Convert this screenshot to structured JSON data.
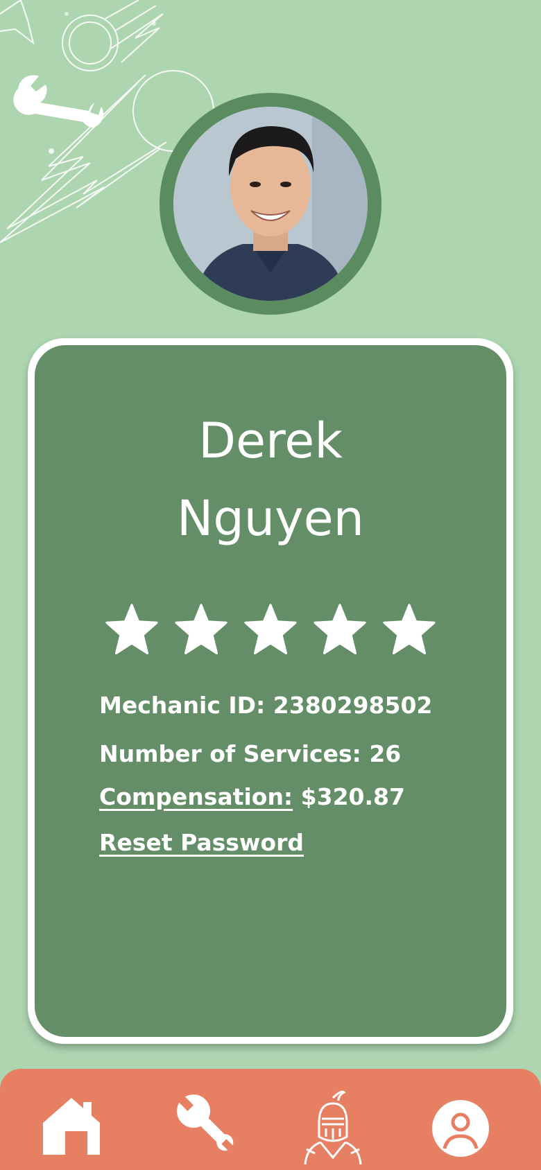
{
  "profile": {
    "first_name": "Derek",
    "last_name": "Nguyen",
    "rating": 5,
    "rating_max": 5,
    "mechanic_id_label": "Mechanic ID:",
    "mechanic_id": "2380298502",
    "services_label": "Number of Services:",
    "services": "26",
    "compensation_label": "Compensation:",
    "compensation": "$320.87",
    "reset_password": "Reset Password"
  },
  "nav": {
    "items": [
      {
        "icon": "home-icon"
      },
      {
        "icon": "wrench-icon"
      },
      {
        "icon": "knight-icon"
      },
      {
        "icon": "user-icon"
      }
    ]
  },
  "colors": {
    "background": "#add5b0",
    "card": "#648e67",
    "avatar_ring": "#5b8c60",
    "navbar": "#e77f62"
  }
}
